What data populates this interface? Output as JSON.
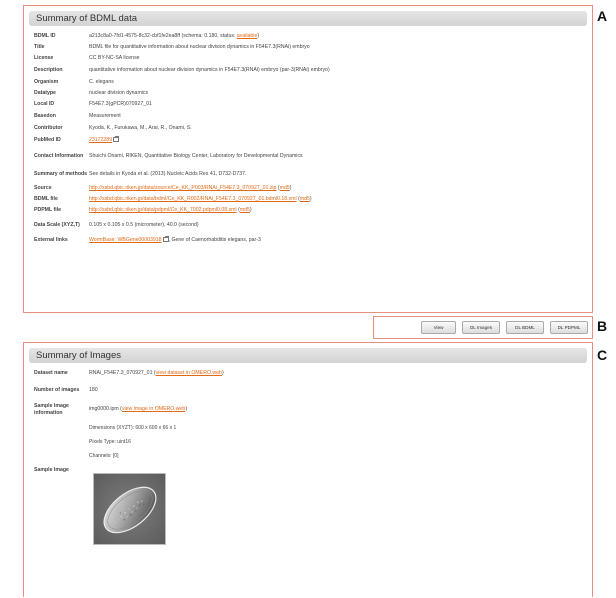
{
  "labels": {
    "a": "A",
    "b": "B",
    "c": "C"
  },
  "bdml": {
    "title": "Summary of BDML data",
    "rows": [
      {
        "key": "BDML ID",
        "value": "a213c8a0-7fd1-4575-8c32-cbf1fe2ea8ff (schema: 0.180, status: ",
        "link": "available",
        "suffix": ")"
      },
      {
        "key": "Title",
        "value": "BDML file for quantitative information about nuclear division dynamics in F54E7.3(RNAi) embryo"
      },
      {
        "key": "License",
        "value": "CC BY-NC-SA license"
      },
      {
        "key": "Description",
        "value": "quantitative information about nuclear division dynamics in F54E7.3(RNAi) embryo (par-3(RNAi) embryo)"
      },
      {
        "key": "Organism",
        "value": "C. elegans"
      },
      {
        "key": "Datatype",
        "value": "nuclear division dynamics"
      },
      {
        "key": "Local ID",
        "value": "F54E7.3(gPCR)070927_01"
      },
      {
        "key": "Basedon",
        "value": "Measurement"
      },
      {
        "key": "Contributor",
        "value": "Kyoda, K., Furukawa, M., Arai, R., Onami, S."
      },
      {
        "key": "PubMed ID",
        "link": "23172289"
      },
      {
        "key": "Contact Information",
        "value": "Shuichi Onami, RIKEN, Quantitative Biology Center, Laboratory for Developmental Dynamics"
      },
      {
        "key": "Summary of methods",
        "value": "See details in Kyoda et al. (2013) Nucleic Acids Res 41, D732-D737."
      },
      {
        "key": "Source",
        "link": "http://ssbd.qbic.riken.jp/data/source/Ce_KK_P003/RNAi_F54E7.3_070927_01.zip",
        "value": " (",
        "link2": "md5",
        "suffix": ")"
      },
      {
        "key": "BDML file",
        "link": "http://ssbd.qbic.riken.jp/data/bdml/Ce_KK_R002/RNAi_F54E7.3_070927_01.bdml0.18.xml",
        "value": " (",
        "link2": "md5",
        "suffix": ")"
      },
      {
        "key": "PDPML file",
        "link": "http://ssbd.qbic.riken.jp/data/pdpml/Ce_KK_7002.pdpml0.08.xml",
        "value": " (",
        "link2": "md5",
        "suffix": ")"
      },
      {
        "key": "Data Scale (XYZ,T)",
        "value": "0.105 x 0.105 x 0.5 (micrometer), 40.0 (second)"
      },
      {
        "key": "External links",
        "link": "WormBase: WBGene00003918",
        "value": ", Gene of Caenorhabditis elegans, par-3"
      }
    ]
  },
  "toolbar": {
    "view": "View",
    "dl_images": "DL Images",
    "dl_bdml": "DL BDML",
    "dl_pdpml": "DL PDPML"
  },
  "images": {
    "title": "Summary of Images",
    "dataset_key": "Dataset name",
    "dataset_value": "RNAi_F54E7.3_070927_01 (",
    "dataset_link": "view dataset in OMERO.web",
    "dataset_suffix": ")",
    "count_key": "Number of images",
    "count_value": "180",
    "sample_key": "Sample Image information",
    "sample_value": "img0000.ipm (",
    "sample_link": "view image in OMERO.web",
    "sample_suffix": ")",
    "dimensions": "Dimensions (XYZT): 600 x 600 x 66 x 1",
    "pixels": "Pixels Type: uint16",
    "channels": "Channels: [0]",
    "sample_image_key": "Sample Image"
  }
}
